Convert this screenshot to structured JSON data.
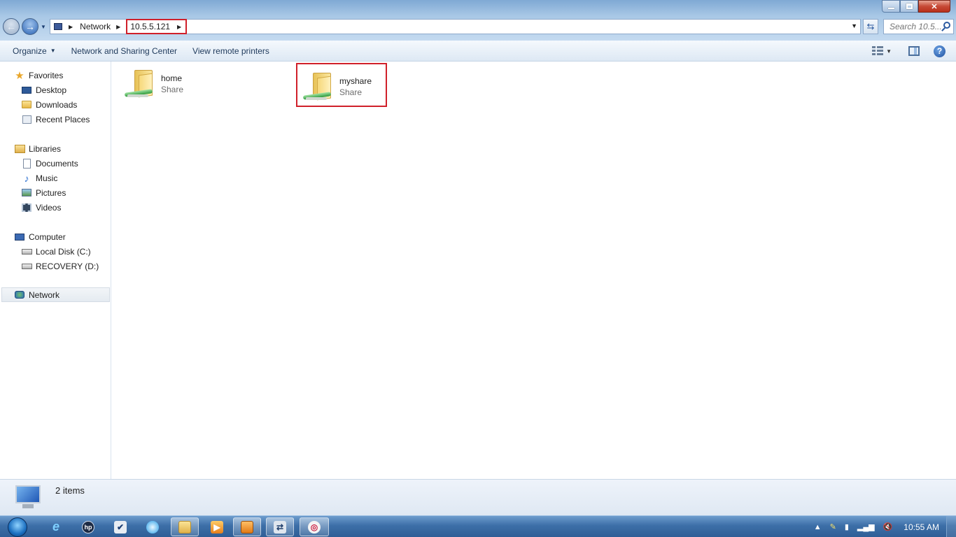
{
  "address": {
    "crumbs": [
      "Network",
      "10.5.5.121"
    ],
    "search_placeholder": "Search 10.5..."
  },
  "commands": {
    "organize": "Organize",
    "network_sharing": "Network and Sharing Center",
    "view_printers": "View remote printers"
  },
  "nav": {
    "favorites": {
      "label": "Favorites",
      "items": [
        "Desktop",
        "Downloads",
        "Recent Places"
      ]
    },
    "libraries": {
      "label": "Libraries",
      "items": [
        "Documents",
        "Music",
        "Pictures",
        "Videos"
      ]
    },
    "computer": {
      "label": "Computer",
      "items": [
        "Local Disk (C:)",
        "RECOVERY (D:)"
      ]
    },
    "network": "Network"
  },
  "shares": [
    {
      "name": "home",
      "type": "Share"
    },
    {
      "name": "myshare",
      "type": "Share"
    }
  ],
  "details": {
    "count": "2 items"
  },
  "taskbar": {
    "clock": "10:55 AM"
  },
  "colors": {
    "highlight": "#d0202a",
    "accent": "#2c5aa0"
  }
}
